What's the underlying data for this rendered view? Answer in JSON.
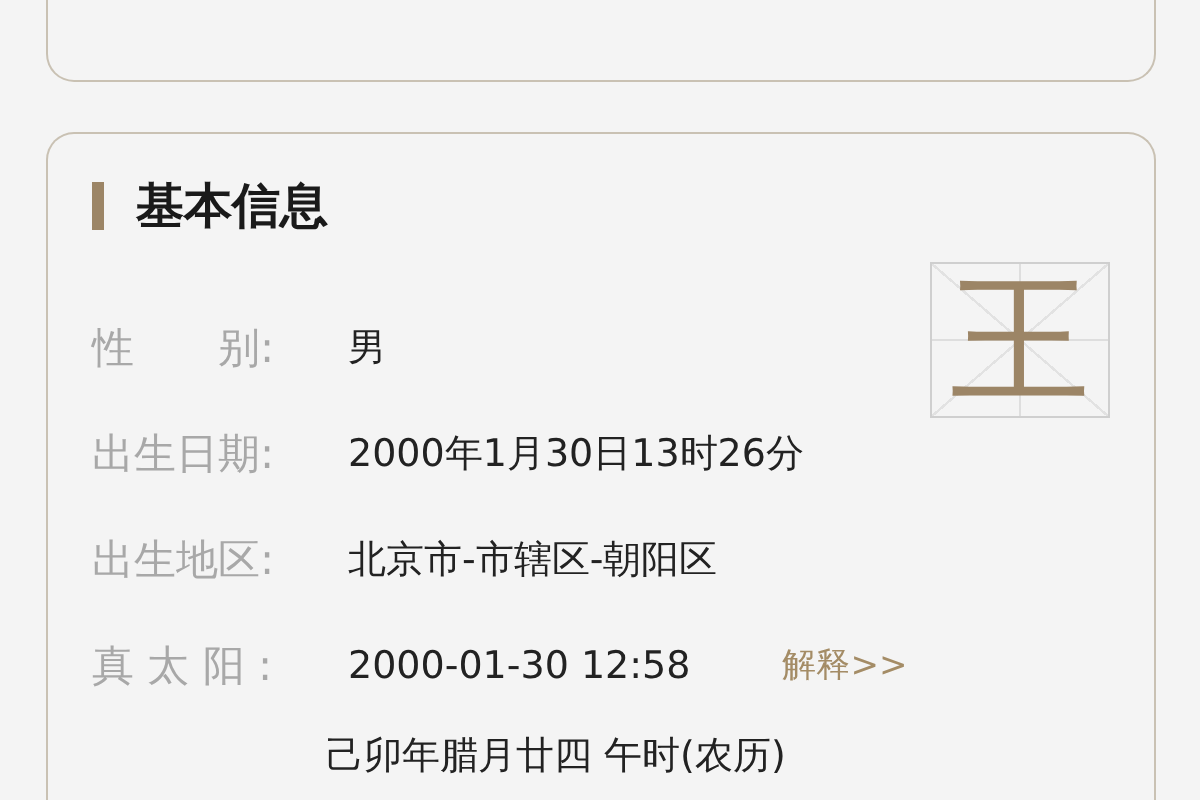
{
  "section": {
    "title": "基本信息"
  },
  "surname": "王",
  "fields": [
    {
      "label": "性　　别:",
      "value": "男"
    },
    {
      "label": "出生日期:",
      "value": "2000年1月30日13时26分"
    },
    {
      "label": "出生地区:",
      "value": "北京市-市辖区-朝阳区"
    },
    {
      "label": "真 太 阳 :",
      "value": "2000-01-30 12:58",
      "link": "解释>>"
    }
  ],
  "lunar": "己卯年腊月廿四 午时(农历)"
}
